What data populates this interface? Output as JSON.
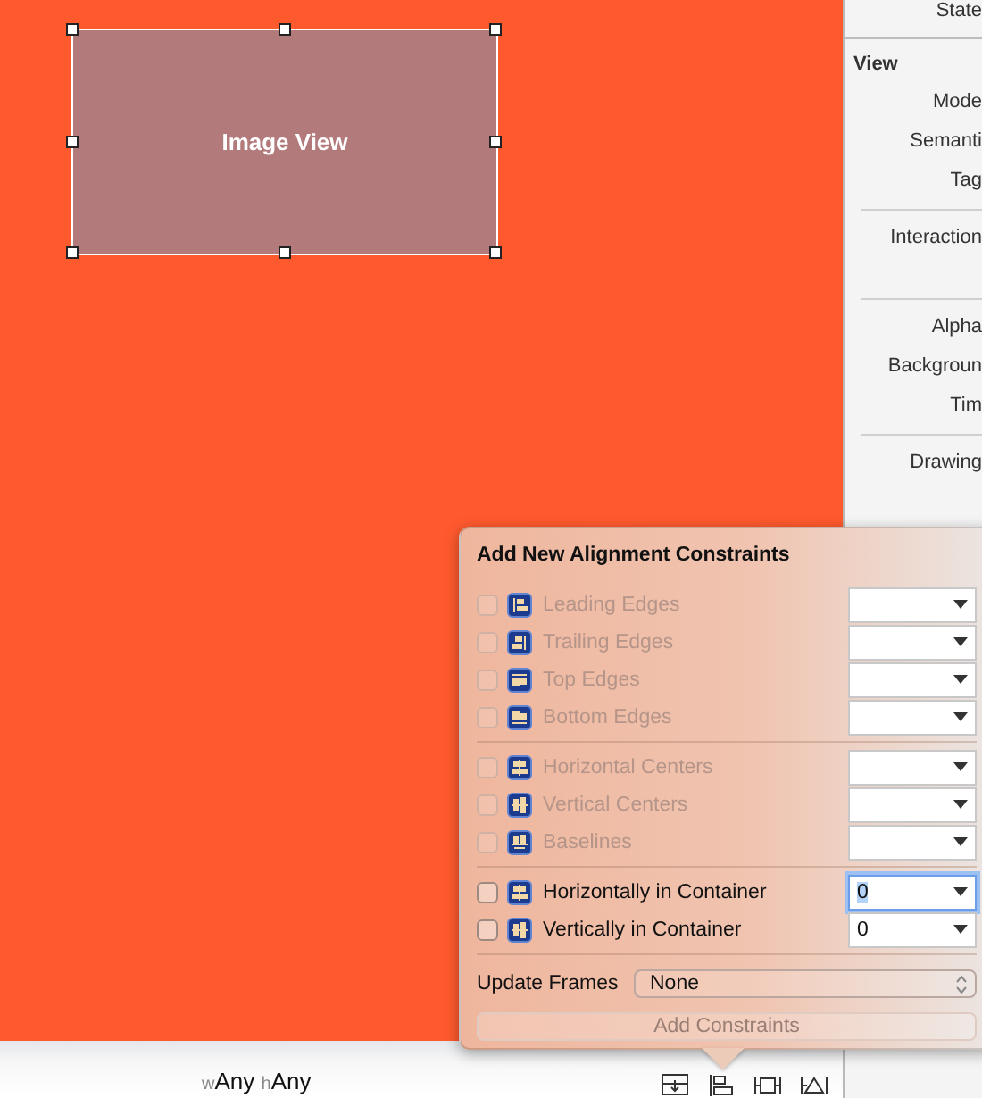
{
  "canvas": {
    "image_view": {
      "label": "Image View",
      "selected": true
    }
  },
  "inspector": {
    "items": [
      {
        "kind": "label",
        "text": "State"
      },
      {
        "kind": "divider"
      },
      {
        "kind": "header",
        "text": "View"
      },
      {
        "kind": "label",
        "text": "Mode"
      },
      {
        "kind": "label",
        "text": "Semanti"
      },
      {
        "kind": "label",
        "text": "Tag"
      },
      {
        "kind": "divider"
      },
      {
        "kind": "label",
        "text": "Interaction"
      },
      {
        "kind": "spacer"
      },
      {
        "kind": "divider"
      },
      {
        "kind": "label",
        "text": "Alpha"
      },
      {
        "kind": "label",
        "text": "Backgroun"
      },
      {
        "kind": "label",
        "text": "Tim"
      },
      {
        "kind": "divider"
      },
      {
        "kind": "label",
        "text": "Drawing"
      }
    ]
  },
  "popover": {
    "title": "Add New Alignment Constraints",
    "groups": [
      [
        {
          "kind": "leading",
          "label": "Leading Edges",
          "checked": false,
          "disabled": true,
          "focused": false
        },
        {
          "kind": "trailing",
          "label": "Trailing Edges",
          "checked": false,
          "disabled": true,
          "focused": false
        },
        {
          "kind": "top",
          "label": "Top Edges",
          "checked": false,
          "disabled": true,
          "focused": false
        },
        {
          "kind": "bottom",
          "label": "Bottom Edges",
          "checked": false,
          "disabled": true,
          "focused": false
        }
      ],
      [
        {
          "kind": "hcenter",
          "label": "Horizontal Centers",
          "checked": false,
          "disabled": true,
          "focused": false
        },
        {
          "kind": "vcenter",
          "label": "Vertical Centers",
          "checked": false,
          "disabled": true,
          "focused": false
        },
        {
          "kind": "baseline",
          "label": "Baselines",
          "checked": false,
          "disabled": true,
          "focused": false
        }
      ],
      [
        {
          "kind": "hcenter",
          "label": "Horizontally in Container",
          "checked": false,
          "disabled": false,
          "value": "0",
          "focused": true
        },
        {
          "kind": "vcenter",
          "label": "Vertically in Container",
          "checked": false,
          "disabled": false,
          "value": "0",
          "focused": false
        }
      ]
    ],
    "update_frames": {
      "label": "Update Frames",
      "value": "None"
    },
    "add_button": {
      "label": "Add Constraints",
      "disabled": true
    }
  },
  "size_class": {
    "width_prefix": "w",
    "width": "Any",
    "height_prefix": "h",
    "height": "Any"
  }
}
